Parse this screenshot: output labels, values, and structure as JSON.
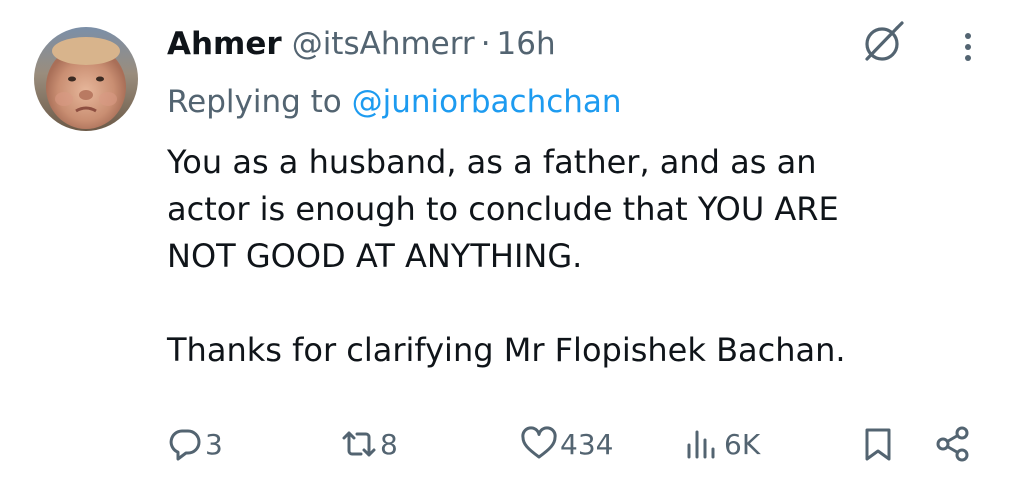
{
  "tweet": {
    "author_name": "Ahmer",
    "author_handle": "@itsAhmerr",
    "separator": "·",
    "time": "16h",
    "replying_prefix": "Replying to ",
    "replying_to": "@juniorbachchan",
    "body_lines": [
      "You as a husband, as a father, and as an",
      "actor is enough to conclude that YOU ARE",
      "NOT GOOD AT ANYTHING."
    ],
    "body_last": "Thanks for clarifying Mr Flopishek Bachan."
  },
  "actions": {
    "replies": "3",
    "retweets": "8",
    "likes": "434",
    "views": "6K"
  },
  "icons": {
    "grok": "grok-icon",
    "more": "more-vertical-icon",
    "reply": "reply-icon",
    "retweet": "retweet-icon",
    "like": "heart-icon",
    "views": "views-icon",
    "bookmark": "bookmark-icon",
    "share": "share-icon"
  },
  "colors": {
    "text": "#0f1419",
    "secondary": "#536471",
    "link": "#1d9bf0"
  }
}
